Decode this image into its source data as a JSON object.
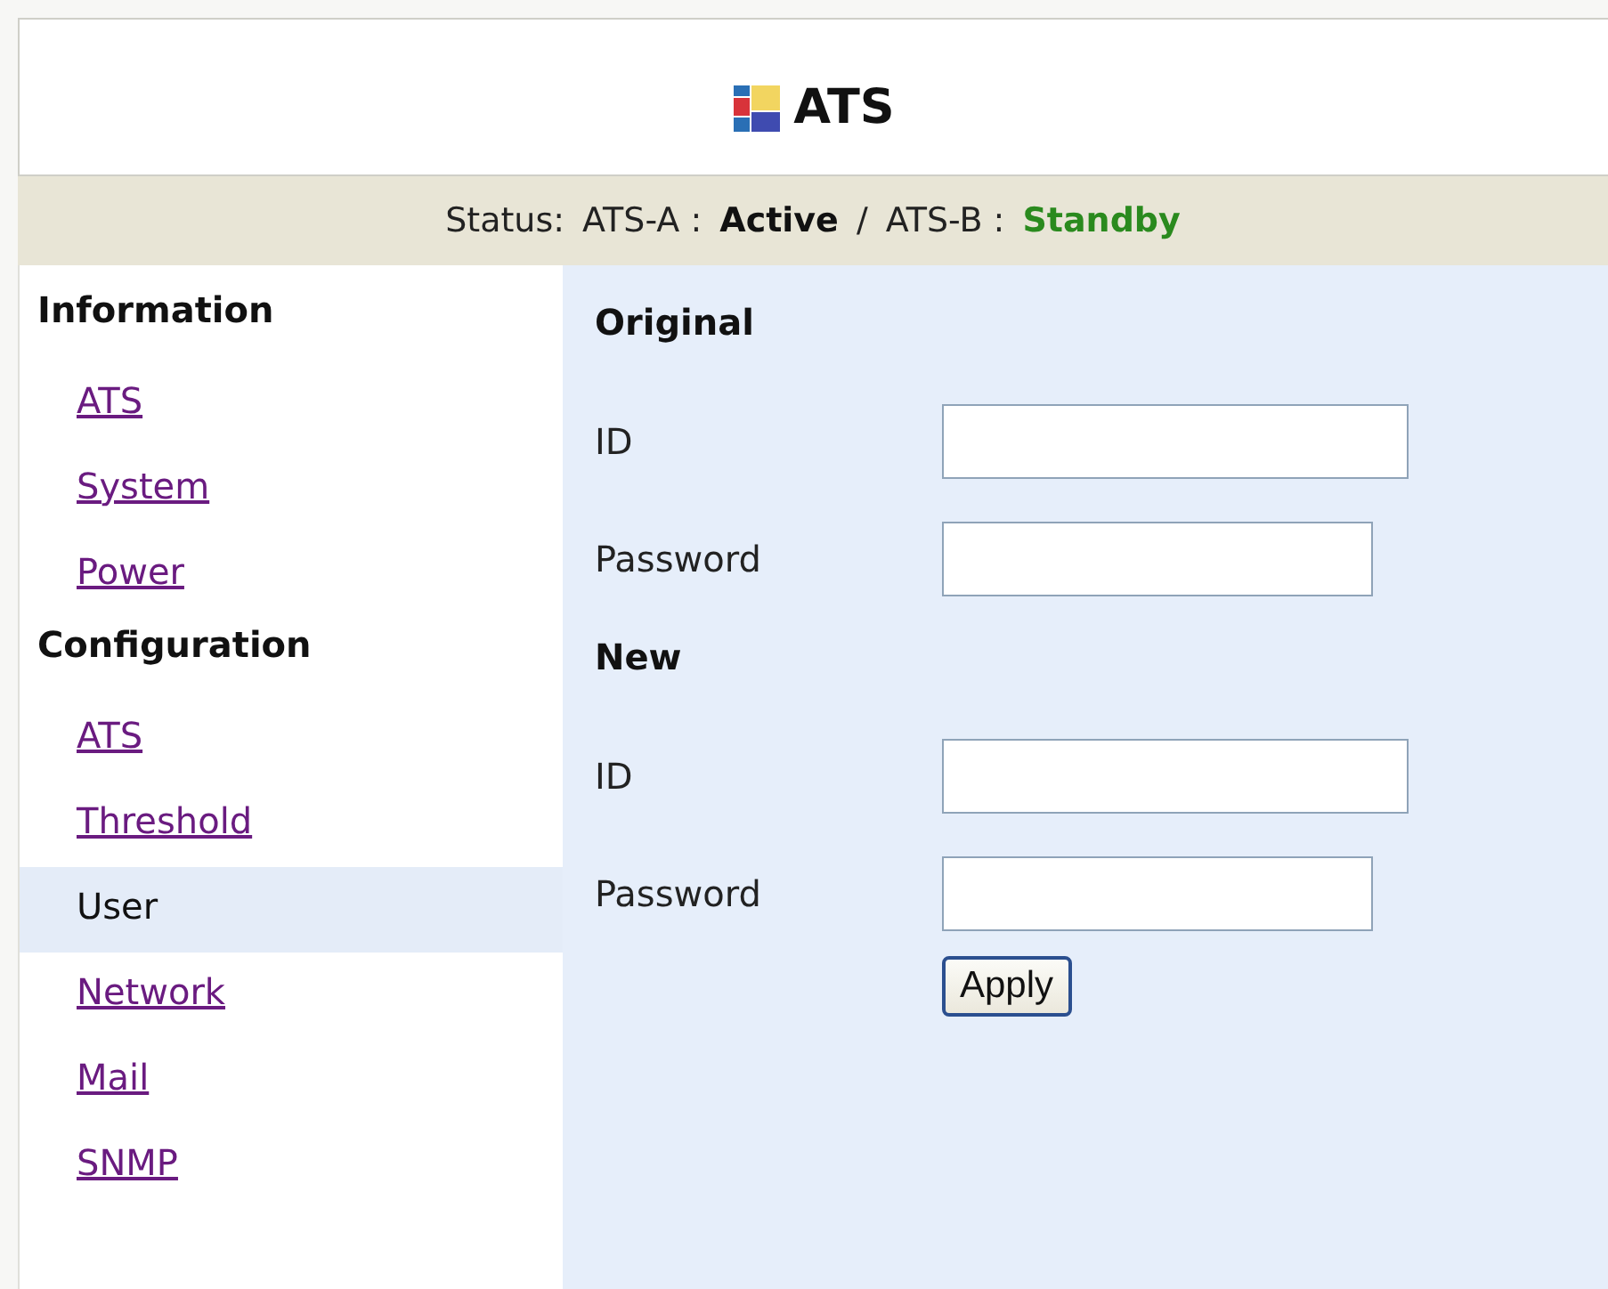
{
  "header": {
    "title": "ATS"
  },
  "status": {
    "label": "Status:",
    "divider": "/",
    "units": [
      {
        "name": "ATS-A :",
        "state": "Active",
        "kind": "active"
      },
      {
        "name": "ATS-B :",
        "state": "Standby",
        "kind": "standby"
      }
    ]
  },
  "sidebar": {
    "sections": [
      {
        "title": "Information",
        "items": [
          {
            "label": "ATS",
            "selected": false
          },
          {
            "label": "System",
            "selected": false
          },
          {
            "label": "Power",
            "selected": false
          }
        ]
      },
      {
        "title": "Configuration",
        "items": [
          {
            "label": "ATS",
            "selected": false
          },
          {
            "label": "Threshold",
            "selected": false
          },
          {
            "label": "User",
            "selected": true
          },
          {
            "label": "Network",
            "selected": false
          },
          {
            "label": "Mail",
            "selected": false
          },
          {
            "label": "SNMP",
            "selected": false
          }
        ]
      }
    ]
  },
  "form": {
    "sections": [
      {
        "title": "Original",
        "fields": [
          {
            "label": "ID",
            "kind": "text"
          },
          {
            "label": "Password",
            "kind": "password"
          }
        ]
      },
      {
        "title": "New",
        "fields": [
          {
            "label": "ID",
            "kind": "text"
          },
          {
            "label": "Password",
            "kind": "password"
          }
        ]
      }
    ],
    "button": "Apply"
  }
}
